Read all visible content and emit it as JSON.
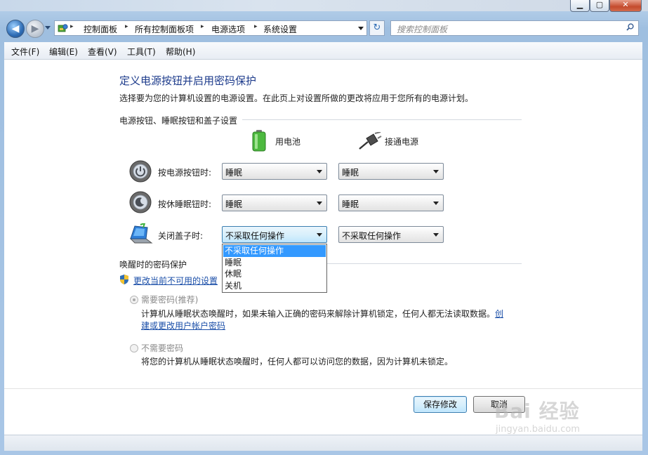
{
  "window": {
    "minimize": "▁",
    "maximize": "▢",
    "close": "✕"
  },
  "nav": {
    "address": [
      "控制面板",
      "所有控制面板项",
      "电源选项",
      "系统设置"
    ],
    "separator": "▸",
    "search_placeholder": "搜索控制面板",
    "refresh": "↻"
  },
  "menu": [
    "文件(F)",
    "编辑(E)",
    "查看(V)",
    "工具(T)",
    "帮助(H)"
  ],
  "page": {
    "title": "定义电源按钮并启用密码保护",
    "description": "选择要为您的计算机设置的电源设置。在此页上对设置所做的更改将应用于您所有的电源计划。"
  },
  "buttons_section": {
    "heading": "电源按钮、睡眠按钮和盖子设置",
    "col_battery": "用电池",
    "col_plugged": "接通电源",
    "rows": [
      {
        "label": "按电源按钮时:",
        "battery": "睡眠",
        "plugged": "睡眠"
      },
      {
        "label": "按休睡眠钮时:",
        "battery": "睡眠",
        "plugged": "睡眠"
      },
      {
        "label": "关闭盖子时:",
        "battery": "不采取任何操作",
        "plugged": "不采取任何操作"
      }
    ],
    "dropdown_options": [
      "不采取任何操作",
      "睡眠",
      "休眠",
      "关机"
    ]
  },
  "password_section": {
    "heading": "唤醒时的密码保护",
    "change_link": "更改当前不可用的设置",
    "require": {
      "label": "需要密码(推荐)",
      "desc": "计算机从睡眠状态唤醒时，如果未输入正确的密码来解除计算机锁定，任何人都无法读取数据。",
      "link_part1": "创",
      "link_part2": "建或更改用户帐户密码"
    },
    "no_require": {
      "label": "不需要密码",
      "desc": "将您的计算机从睡眠状态唤醒时，任何人都可以访问您的数据，因为计算机未锁定。"
    }
  },
  "footer": {
    "save": "保存修改",
    "cancel": "取消"
  },
  "watermark": {
    "big": "Bai 经验",
    "small": "jingyan.baidu.com"
  }
}
